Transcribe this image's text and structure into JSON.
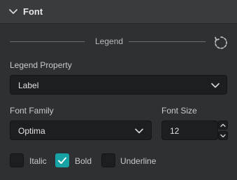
{
  "section": {
    "title": "Font",
    "toggle_icon": "chevron-down-icon"
  },
  "legend_divider": {
    "label": "Legend",
    "reset_icon": "reset-rotate-icon"
  },
  "legend_property": {
    "label": "Legend Property",
    "selected": "Label"
  },
  "font_family": {
    "label": "Font Family",
    "selected": "Optima"
  },
  "font_size": {
    "label": "Font Size",
    "value": "12"
  },
  "styles": [
    {
      "label": "Italic",
      "checked": false
    },
    {
      "label": "Bold",
      "checked": true
    },
    {
      "label": "Underline",
      "checked": false
    }
  ],
  "colors": {
    "accent": "#17a3a6",
    "panel": "#2f3033",
    "input": "#1d1e21"
  }
}
